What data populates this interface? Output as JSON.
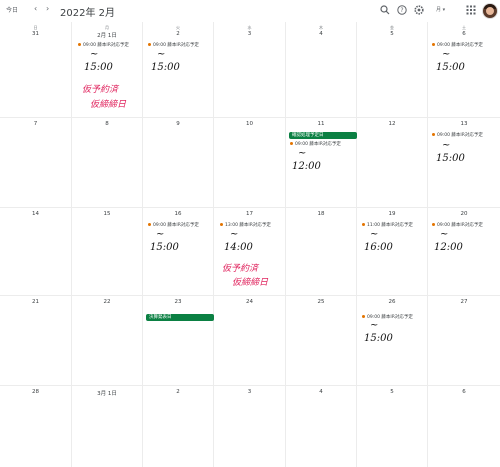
{
  "toolbar": {
    "today_label": "今日",
    "prev_icon": "chevron-left-icon",
    "next_icon": "chevron-right-icon",
    "title": "2022年 2月",
    "view_label": "月 ▾",
    "icons": [
      "search-icon",
      "help-icon",
      "settings-icon",
      "apps-icon"
    ]
  },
  "weekdays": [
    "日",
    "月",
    "火",
    "水",
    "木",
    "金",
    "土"
  ],
  "weeks": [
    [
      "31",
      "2月 1日",
      "2",
      "3",
      "4",
      "5",
      "6"
    ],
    [
      "7",
      "8",
      "9",
      "10",
      "11",
      "12",
      "13"
    ],
    [
      "14",
      "15",
      "16",
      "17",
      "18",
      "19",
      "20"
    ],
    [
      "21",
      "22",
      "23",
      "24",
      "25",
      "26",
      "27"
    ],
    [
      "28",
      "3月 1日",
      "2",
      "3",
      "4",
      "5",
      "6"
    ]
  ],
  "events": {
    "w0_mon": "09:00 藤本IR対応予定",
    "w0_tue": "09:00 藤本IR対応予定",
    "w0_sat": "09:00 藤本IR対応予定",
    "w1_thu_bar": "確認処理予定日",
    "w1_thu": "09:00 藤本IR対応予定",
    "w1_sat": "09:00 藤本IR対応予定",
    "w2_tue": "09:00 藤本IR対応予定",
    "w2_wed": "13:00 藤本IR対応予定",
    "w2_fri": "11:00 藤本IR対応予定",
    "w2_sat": "09:00 藤本IR対応予定",
    "w3_tue_bar": "決算発表日",
    "w3_fri": "09:00 藤本IR対応予定"
  },
  "handwriting": {
    "tilde": "~",
    "t1500": "15:00",
    "t1200": "12:00",
    "t1400": "14:00",
    "t1600": "16:00",
    "red_line1": "仮予約済",
    "red_line2": "仮締締日"
  },
  "colors": {
    "event_dot": "#e37400",
    "bar_green": "#0b8043",
    "handwriting_red": "#e0245e"
  }
}
